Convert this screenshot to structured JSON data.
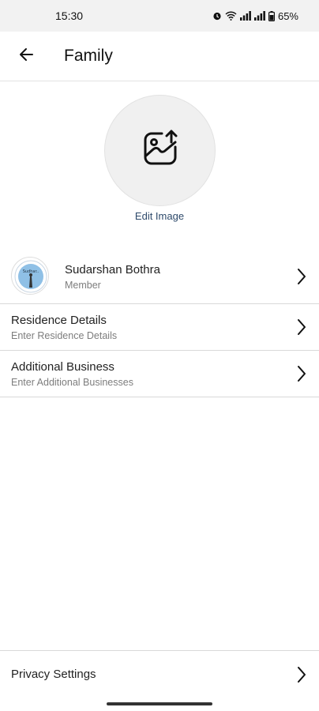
{
  "status_bar": {
    "time": "15:30",
    "battery": "65%"
  },
  "header": {
    "title": "Family",
    "back_icon": "arrow-left-icon"
  },
  "profile_image": {
    "icon": "image-upload-icon",
    "edit_label": "Edit Image"
  },
  "member": {
    "name": "Sudarshan Bothra",
    "role": "Member",
    "avatar_text": "Sudhar.."
  },
  "sections": [
    {
      "title": "Residence Details",
      "subtitle": "Enter Residence Details"
    },
    {
      "title": "Additional Business",
      "subtitle": "Enter Additional Businesses"
    }
  ],
  "footer": {
    "privacy_label": "Privacy Settings"
  },
  "colors": {
    "accent_link": "#2e4a6b",
    "divider": "#d9d9d9",
    "status_bg": "#f2f2f2"
  }
}
